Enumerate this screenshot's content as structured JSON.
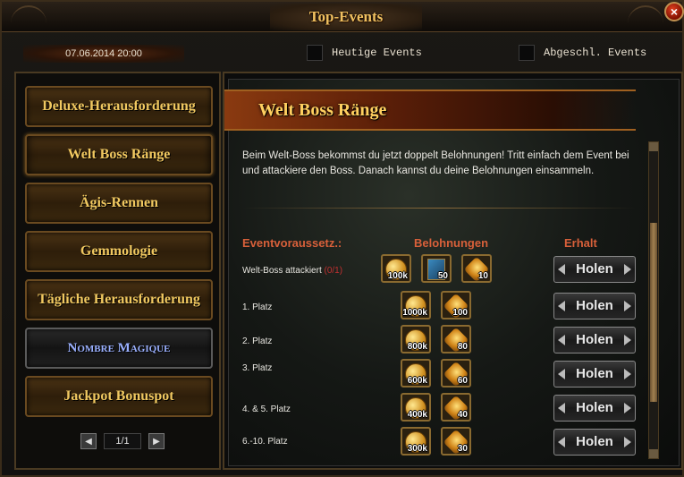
{
  "window": {
    "title": "Top-Events",
    "close_label": "×"
  },
  "header": {
    "datetime": "07.06.2014 20:00",
    "filters": [
      {
        "label": "Heutige Events",
        "checked": false
      },
      {
        "label": "Abgeschl. Events",
        "checked": false
      }
    ]
  },
  "sidebar": {
    "items": [
      {
        "label": "Deluxe-Herausforderung"
      },
      {
        "label": "Welt Boss Ränge"
      },
      {
        "label": "Ägis-Rennen"
      },
      {
        "label": "Gemmologie"
      },
      {
        "label": "Tägliche Herausforderung"
      },
      {
        "label": "Nombre Magique"
      },
      {
        "label": "Jackpot Bonuspot"
      }
    ],
    "pager": {
      "prev": "◀",
      "text": "1/1",
      "next": "▶"
    }
  },
  "main": {
    "title": "Welt Boss Ränge",
    "description": "Beim Welt-Boss bekommst du jetzt doppelt Belohnungen! Tritt einfach dem Event bei und attackiere den Boss. Danach kannst du deine Belohnungen einsammeln.",
    "columns": {
      "requirement": "Eventvoraussetz.:",
      "rewards": "Belohnungen",
      "claim": "Erhalt"
    },
    "rows": [
      {
        "label": "Welt-Boss attackiert ",
        "progress": "(0/1)",
        "rewards": [
          {
            "type": "coin",
            "qty": "100k"
          },
          {
            "type": "book",
            "qty": "50"
          },
          {
            "type": "orb",
            "qty": "10"
          }
        ],
        "button": "Holen"
      },
      {
        "label": "1. Platz",
        "progress": "",
        "rewards": [
          {
            "type": "coin",
            "qty": "1000k"
          },
          {
            "type": "orb",
            "qty": "100"
          }
        ],
        "button": "Holen"
      },
      {
        "label": "2. Platz",
        "progress": "",
        "rewards": [
          {
            "type": "coin",
            "qty": "800k"
          },
          {
            "type": "orb",
            "qty": "80"
          }
        ],
        "button": "Holen"
      },
      {
        "label": "3. Platz",
        "progress": "",
        "rewards": [
          {
            "type": "coin",
            "qty": "600k"
          },
          {
            "type": "orb",
            "qty": "60"
          }
        ],
        "button": "Holen"
      },
      {
        "label": "4. & 5. Platz",
        "progress": "",
        "rewards": [
          {
            "type": "coin",
            "qty": "400k"
          },
          {
            "type": "orb",
            "qty": "40"
          }
        ],
        "button": "Holen"
      },
      {
        "label": "6.-10. Platz",
        "progress": "",
        "rewards": [
          {
            "type": "coin",
            "qty": "300k"
          },
          {
            "type": "orb",
            "qty": "30"
          }
        ],
        "button": "Holen"
      }
    ]
  },
  "colors": {
    "accent_gold": "#f0c860",
    "header_red": "#d8603a",
    "progress_red": "#c03030"
  }
}
